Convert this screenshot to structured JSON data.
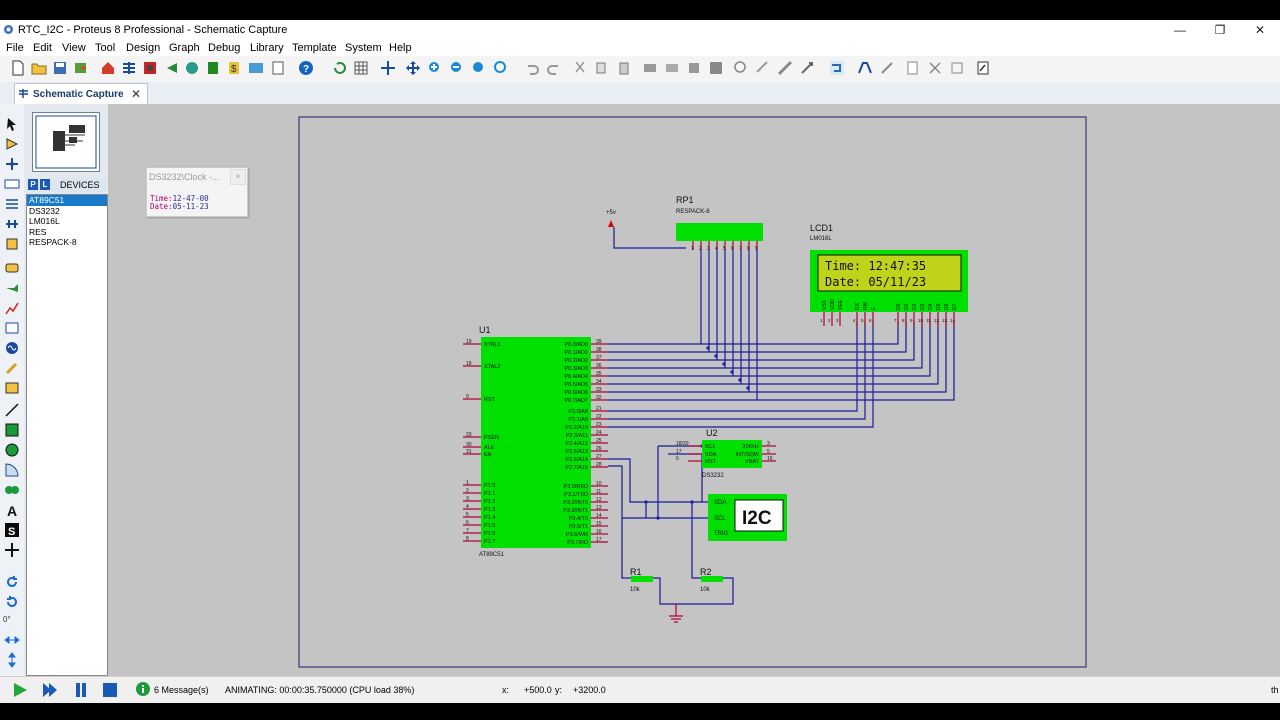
{
  "window": {
    "title": "RTC_I2C - Proteus 8 Professional - Schematic Capture",
    "min": "—",
    "max": "❐",
    "close": "✕"
  },
  "menu": [
    "File",
    "Edit",
    "View",
    "Tool",
    "Design",
    "Graph",
    "Debug",
    "Library",
    "Template",
    "System",
    "Help"
  ],
  "tab": {
    "label": "Schematic Capture",
    "close": "✕"
  },
  "devices": {
    "header": "DEVICES",
    "p": "P",
    "l": "L",
    "items": [
      "AT89C51",
      "DS3232",
      "LM016L",
      "RES",
      "RESPACK-8"
    ],
    "selected": 0
  },
  "left_angle": "0°",
  "popup": {
    "title": "DS3232\\Clock -...",
    "close": "×",
    "time_label": "Time:",
    "time_value": "12-47-00",
    "date_label": "Date:",
    "date_value": "05-11-23"
  },
  "schematic": {
    "u1": {
      "ref": "U1",
      "part": "AT89C51"
    },
    "u2": {
      "ref": "U2",
      "part": "DS3232"
    },
    "rp1": {
      "ref": "RP1",
      "part": "RESPACK-8"
    },
    "lcd1": {
      "ref": "LCD1",
      "part": "LM016L",
      "line1": "Time: 12:47:35",
      "line2": "Date: 05/11/23"
    },
    "power": "+5v",
    "i2c": "I2C",
    "i2c_pins": [
      "SDA",
      "SCL",
      "TRIG"
    ],
    "r1": {
      "ref": "R1",
      "value": "10k"
    },
    "r2": {
      "ref": "R2",
      "value": "10k"
    },
    "u1_left_pins": [
      {
        "num": "19",
        "name": "XTAL1"
      },
      {
        "num": "18",
        "name": "XTAL2"
      },
      {
        "num": "9",
        "name": "RST"
      },
      {
        "num": "29",
        "name": "PSEN"
      },
      {
        "num": "30",
        "name": "ALE"
      },
      {
        "num": "31",
        "name": "EA"
      },
      {
        "num": "1",
        "name": "P1.0"
      },
      {
        "num": "2",
        "name": "P1.1"
      },
      {
        "num": "3",
        "name": "P1.2"
      },
      {
        "num": "4",
        "name": "P1.3"
      },
      {
        "num": "5",
        "name": "P1.4"
      },
      {
        "num": "6",
        "name": "P1.5"
      },
      {
        "num": "7",
        "name": "P1.6"
      },
      {
        "num": "8",
        "name": "P1.7"
      }
    ],
    "u1_right_pins": [
      {
        "num": "39",
        "name": "P0.0/AD0"
      },
      {
        "num": "38",
        "name": "P0.1/AD1"
      },
      {
        "num": "37",
        "name": "P0.2/AD2"
      },
      {
        "num": "36",
        "name": "P0.3/AD3"
      },
      {
        "num": "35",
        "name": "P0.4/AD4"
      },
      {
        "num": "34",
        "name": "P0.5/AD5"
      },
      {
        "num": "33",
        "name": "P0.6/AD6"
      },
      {
        "num": "32",
        "name": "P0.7/AD7"
      },
      {
        "num": "21",
        "name": "P2.0/A8"
      },
      {
        "num": "22",
        "name": "P2.1/A9"
      },
      {
        "num": "23",
        "name": "P2.2/A10"
      },
      {
        "num": "24",
        "name": "P2.3/A11"
      },
      {
        "num": "25",
        "name": "P2.4/A12"
      },
      {
        "num": "26",
        "name": "P2.5/A13"
      },
      {
        "num": "27",
        "name": "P2.6/A14"
      },
      {
        "num": "28",
        "name": "P2.7/A15"
      },
      {
        "num": "10",
        "name": "P3.0/RXD"
      },
      {
        "num": "11",
        "name": "P3.1/TXD"
      },
      {
        "num": "12",
        "name": "P3.2/INT0"
      },
      {
        "num": "13",
        "name": "P3.3/INT1"
      },
      {
        "num": "14",
        "name": "P3.4/T0"
      },
      {
        "num": "15",
        "name": "P3.5/T1"
      },
      {
        "num": "16",
        "name": "P3.6/WR"
      },
      {
        "num": "17",
        "name": "P3.7/RD"
      }
    ],
    "u2_left_pins": [
      {
        "num": "18/20",
        "name": "SCL"
      },
      {
        "num": "17",
        "name": "SDA"
      },
      {
        "num": "6",
        "name": "RST"
      }
    ],
    "u2_right_pins": [
      {
        "num": "3",
        "name": "32KHz"
      },
      {
        "num": "5",
        "name": "INT/SQW"
      },
      {
        "num": "16",
        "name": "VBAT"
      }
    ],
    "lcd_pins": [
      "VSS",
      "VDD",
      "VEE",
      "RS",
      "RW",
      "E",
      "D0",
      "D1",
      "D2",
      "D3",
      "D4",
      "D5",
      "D6",
      "D7"
    ],
    "lcd_pin_nums": [
      "1",
      "2",
      "3",
      "4",
      "5",
      "6",
      "7",
      "8",
      "9",
      "10",
      "11",
      "12",
      "13",
      "14"
    ],
    "rp_pin_nums": [
      "1",
      "2",
      "3",
      "4",
      "5",
      "6",
      "7",
      "8",
      "9"
    ]
  },
  "status": {
    "messages": "6 Message(s)",
    "animating": "ANIMATING: 00:00:35.750000 (CPU load 38%)",
    "x_label": "x:",
    "x_value": "+500.0",
    "y_label": "y:",
    "y_value": "+3200.0",
    "th": "th"
  },
  "colors": {
    "chip": "#00e600",
    "wire": "#1a1a9a",
    "pin": "#b00030",
    "lcd_screen": "#c0d21a"
  }
}
